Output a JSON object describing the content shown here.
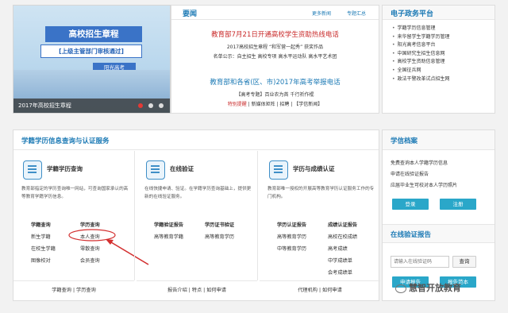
{
  "banner": {
    "title": "高校招生章程",
    "subtitle": "[上级主管部门审核通过]",
    "tag": "阳光高考",
    "caption": "2017年高校招生章程"
  },
  "news": {
    "header": "要闻",
    "more_link": "更多新闻",
    "topic_link": "专题汇总",
    "headline1": "教育部7月21日开通高校学生资助热线电话",
    "line1": "2017高校招生章程 “和军营一起秀” 获奖作品",
    "line2": "名单公示：自主招生 高校专项 高水平运动队 高水平艺术团",
    "headline2": "教育部和各省(区、市)2017年高考举报电话",
    "line3": "【高考专题】百业农为首 千行祈作棍",
    "line4_special": "特别提醒",
    "line4_rest": "| 新媒体矩阵 | 招聘 | 【学信新闻】"
  },
  "gov": {
    "header": "电子政务平台",
    "items": [
      "学籍学历信息管理",
      "来华留学生学籍学历管理",
      "阳光高考信息平台",
      "中国研究生招生信息网",
      "高校学生资助信息管理",
      "全国征兵网",
      "政法干警改革试点招生网"
    ]
  },
  "svc": {
    "header": "学籍学历信息查询与认证服务",
    "col1": {
      "title": "学籍学历查询",
      "desc": "教育部指定的学历查询唯一网站，可查询国家承认的高等教育学籍学历信息。",
      "links": {
        "a": "学籍查询",
        "b": "学历查询",
        "c": "新生学籍",
        "d": "本人查询",
        "e": "在校生学籍",
        "f": "零散查询",
        "g": "图像校对",
        "h": "会员查询"
      },
      "foot": "学籍查询   |   学历查询"
    },
    "col2": {
      "title": "在线验证",
      "desc": "在线快捷申请、验证。在学籍学历查询基础上，提供更新的在线验证服务。",
      "links": {
        "a": "学籍验证报告",
        "b": "学历证书验证",
        "c": "高等教育学籍",
        "d": "高等教育学历"
      },
      "foot": "报告介绍   |   特点   |   如何申请"
    },
    "col3": {
      "title": "学历与成绩认证",
      "desc": "教育部唯一授权的开展高等教育学历认证服务工作的专门机构。",
      "links": {
        "a": "学历认证报告",
        "b": "成绩认证报告",
        "c": "高等教育学历",
        "d": "高校在校成绩",
        "e": "中等教育学历",
        "f": "高考成绩",
        "g": "中学成绩单",
        "h": "会考成绩单"
      },
      "foot": "代理机构   |   如何申请"
    }
  },
  "arch": {
    "header": "学信档案",
    "line1": "免费查询本人学籍学历信息",
    "line2": "申请在线验证报告",
    "line3": "应届毕业生可校对本人学历照片",
    "login": "登录",
    "register": "注册",
    "verify_header": "在线验证报告",
    "verify_placeholder": "请输入在线验证码",
    "query_button": "查询",
    "apply_button": "申请报告",
    "note_button": "报告范本"
  },
  "watermark": "慧智开放教育"
}
